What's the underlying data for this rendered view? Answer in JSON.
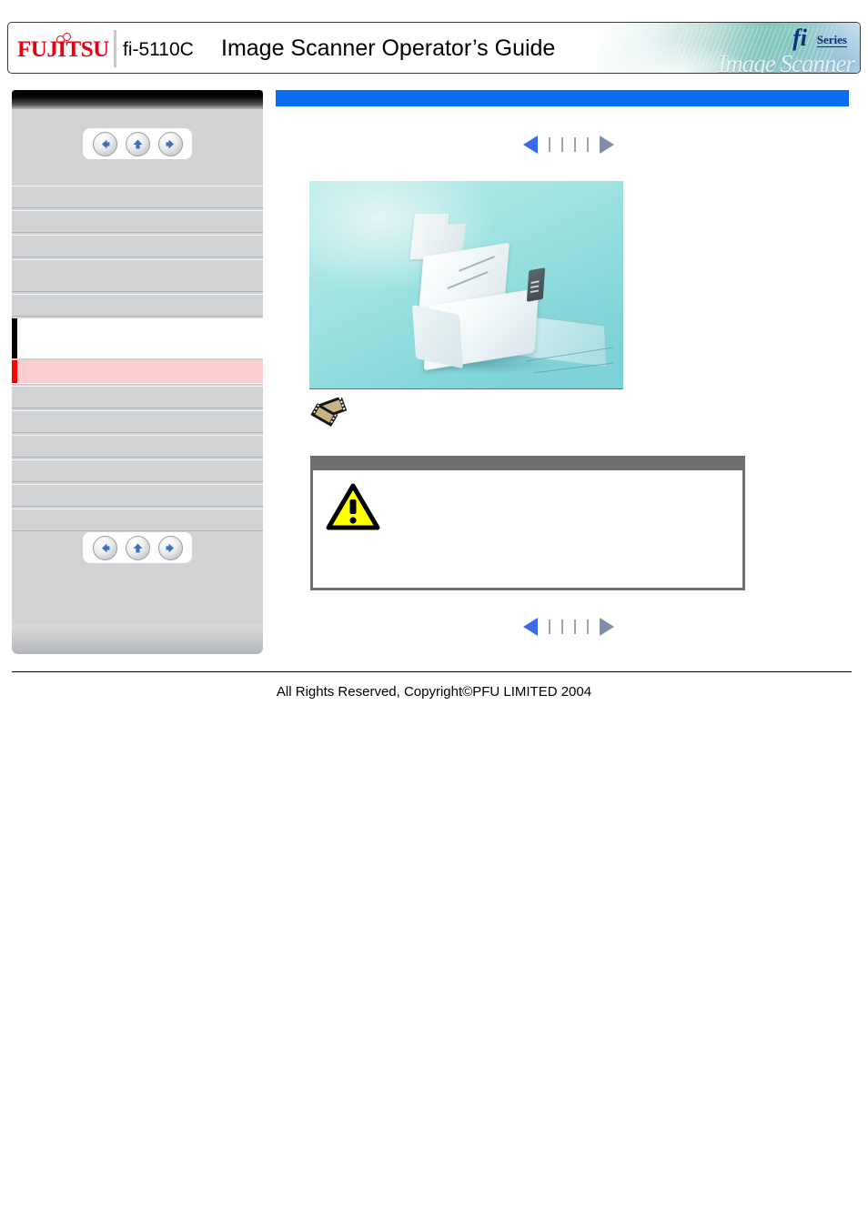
{
  "header": {
    "logo_text": "FUJITSU",
    "logo_icon": "fujitsu-infinity-logo",
    "model": "fi-5110C",
    "title": "Image Scanner Operator’s Guide",
    "banner": {
      "fi": "fi",
      "series": "Series",
      "tagline": "Image Scanner"
    }
  },
  "sidebar": {
    "nav_top": {
      "back_label": "",
      "up_label": "",
      "forward_label": ""
    },
    "nav_bottom": {
      "back_label": "",
      "up_label": "",
      "forward_label": ""
    },
    "items": [
      {
        "label": "",
        "style": "gray",
        "size": "h1"
      },
      {
        "label": "",
        "style": "gray",
        "size": "h1"
      },
      {
        "label": "",
        "style": "gray",
        "size": "h1"
      },
      {
        "label": "",
        "style": "gray",
        "size": "h2"
      },
      {
        "label": "",
        "style": "gray",
        "size": "h1"
      },
      {
        "label": "",
        "style": "white",
        "size": "h2"
      },
      {
        "label": "",
        "style": "pink",
        "size": "h1"
      },
      {
        "label": "",
        "style": "gray",
        "size": "h1"
      },
      {
        "label": "",
        "style": "gray",
        "size": "h1"
      },
      {
        "label": "",
        "style": "gray",
        "size": "h1"
      },
      {
        "label": "",
        "style": "gray",
        "size": "h1"
      },
      {
        "label": "",
        "style": "gray",
        "size": "h1"
      },
      {
        "label": "",
        "style": "gray",
        "size": "h1"
      }
    ]
  },
  "content": {
    "section_title": "",
    "pager_top": {
      "prev_label": "",
      "next_label": "",
      "ticks": 4
    },
    "pager_bottom": {
      "prev_label": "",
      "next_label": "",
      "ticks": 4
    },
    "figure": {
      "alt": "fi-5110C image scanner photograph",
      "caption": ""
    },
    "movie_icon": {
      "name": "film-clip-icon",
      "label": ""
    },
    "caution": {
      "header_label": "",
      "icon": "warning-triangle-icon",
      "text": ""
    }
  },
  "footer": {
    "copyright": "All Rights Reserved,  Copyright©PFU LIMITED 2004"
  },
  "colors": {
    "brand_red": "#e60012",
    "title_bar_blue": "#0a6bf5",
    "pager_active": "#3a6ae8",
    "pager_inactive": "#7f8fa8",
    "current_item_bg": "#fbcfcf",
    "current_item_bar": "#ff0000",
    "section_item_bar": "#000000",
    "sidebar_bg": "#d0d2d4",
    "caution_border": "#6f6f6f",
    "warning_yellow": "#ffff00"
  }
}
